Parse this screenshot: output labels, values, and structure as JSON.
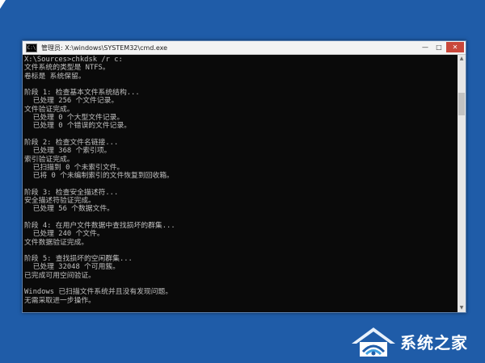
{
  "window": {
    "title": "管理员: X:\\windows\\SYSTEM32\\cmd.exe",
    "icon": "cmd-icon",
    "controls": {
      "minimize": "—",
      "maximize": "□",
      "close": "✕"
    }
  },
  "console": {
    "lines": [
      "X:\\Sources>chkdsk /r c:",
      "文件系统的类型是 NTFS。",
      "卷标是 系统保留。",
      "",
      "阶段 1: 检查基本文件系统结构...",
      "  已处理 256 个文件记录。",
      "文件验证完成。",
      "  已处理 0 个大型文件记录。",
      "  已处理 0 个错误的文件记录。",
      "",
      "阶段 2: 检查文件名链接...",
      "  已处理 368 个索引项。",
      "索引验证完成。",
      "  已扫描到 0 个未索引文件。",
      "  已将 0 个未编制索引的文件恢复到回收箱。",
      "",
      "阶段 3: 检查安全描述符...",
      "安全描述符验证完成。",
      "  已处理 56 个数据文件。",
      "",
      "阶段 4: 在用户文件数据中查找损坏的群集...",
      "  已处理 240 个文件。",
      "文件数据验证完成。",
      "",
      "阶段 5: 查找损坏的空闲群集...",
      "  已处理 32048 个可用簇。",
      "已完成可用空间验证。",
      "",
      "Windows 已扫描文件系统并且没有发现问题。",
      "无需采取进一步操作。"
    ]
  },
  "watermark": {
    "text": "系统之家",
    "icon": "house-logo-icon"
  }
}
